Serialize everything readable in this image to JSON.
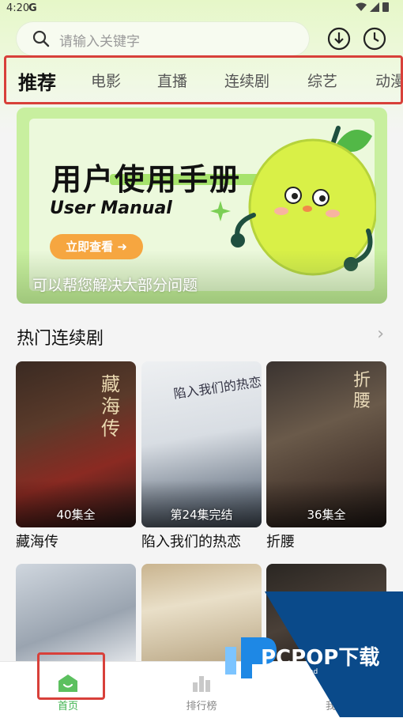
{
  "status": {
    "time": "4:20",
    "carrier_glyph": "G",
    "right_icons": "▾◢▮"
  },
  "search": {
    "placeholder": "请输入关键字"
  },
  "tabs": [
    {
      "label": "推荐"
    },
    {
      "label": "电影"
    },
    {
      "label": "直播"
    },
    {
      "label": "连续剧"
    },
    {
      "label": "综艺"
    },
    {
      "label": "动漫"
    }
  ],
  "banner": {
    "title": "用户使用手册",
    "subtitle": "User Manual",
    "button": "立即查看 ➜",
    "caption": "可以帮您解决大部分问题"
  },
  "section": {
    "title": "热门连续剧",
    "more": "›"
  },
  "cards": [
    {
      "title": "藏海传",
      "episodes": "40集全"
    },
    {
      "title": "陷入我们的热恋",
      "episodes": "第24集完结"
    },
    {
      "title": "折腰",
      "episodes": "36集全"
    }
  ],
  "bottom_nav": [
    {
      "label": "首页"
    },
    {
      "label": "排行榜"
    },
    {
      "label": "我的"
    }
  ],
  "watermark": {
    "brand": "PCPOP下载",
    "sub": "PCPOP Download"
  },
  "colors": {
    "accent_green": "#3fb34f",
    "highlight_red": "#d8403a",
    "banner_button": "#f6a640"
  }
}
